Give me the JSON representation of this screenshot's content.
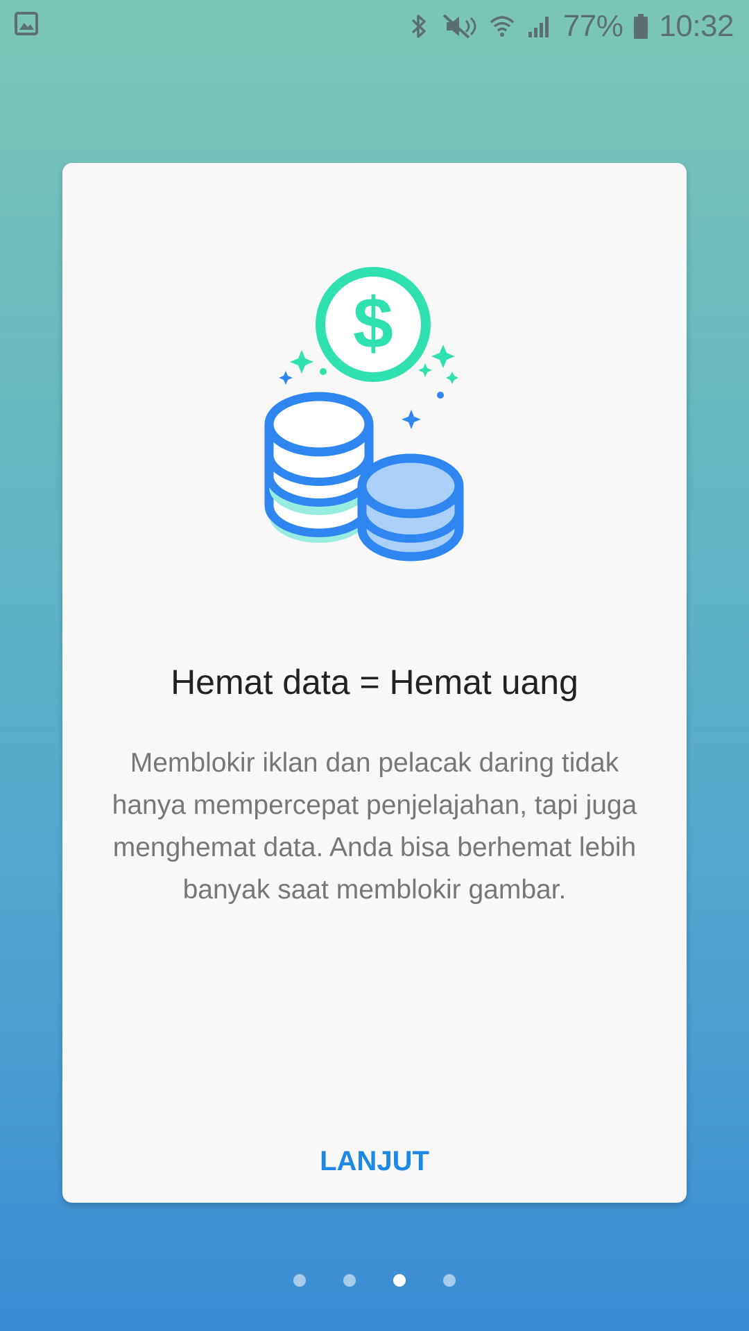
{
  "status_bar": {
    "left_icon": "gallery-icon",
    "icons": [
      "bluetooth-icon",
      "mute-icon",
      "wifi-icon",
      "signal-icon"
    ],
    "battery_percent": "77%",
    "battery_icon": "battery-icon",
    "time": "10:32"
  },
  "card": {
    "illustration_icon": "coins-money-icon",
    "title": "Hemat data = Hemat uang",
    "description": "Memblokir iklan dan pelacak daring tidak hanya mempercepat penjelajahan, tapi juga menghemat data. Anda bisa berhemat lebih banyak saat memblokir gambar.",
    "next_label": "LANJUT"
  },
  "pagination": {
    "total_pages": 4,
    "current_page": 3
  },
  "colors": {
    "accent": "#1e88e5",
    "coin_green": "#2fe0b0",
    "coin_blue": "#2f86f0"
  }
}
